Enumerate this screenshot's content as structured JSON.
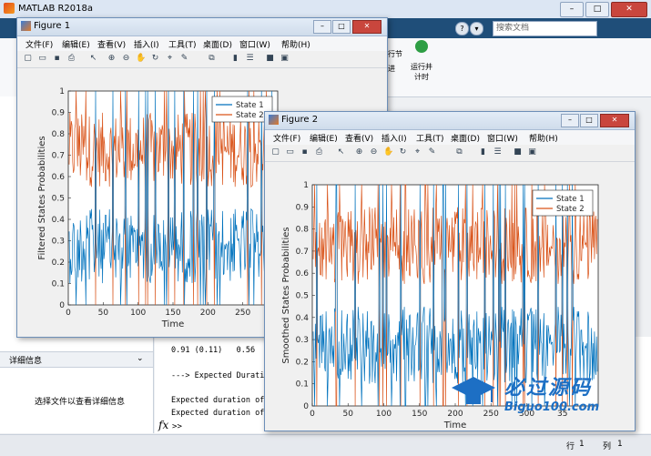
{
  "main_window": {
    "title": "MATLAB R2018a",
    "search_placeholder": "搜索文档",
    "ribbon": {
      "run_advance": "运行并\n计时",
      "run_section": "运行节",
      "advance": "前进"
    },
    "window_controls": {
      "minimize": "–",
      "maximize": "□",
      "close": "✕"
    }
  },
  "left_panel": {
    "details_label": "详细信息",
    "details_message": "选择文件以查看详细信息"
  },
  "command_window": {
    "lines": [
      "0.91 (0.11)   0.56  (",
      "---> Expected Durati",
      "Expected duration of",
      "Expected duration of"
    ],
    "prompt_symbol": "fx",
    "prompt": ">>"
  },
  "status_bar": {
    "row_label": "行",
    "row_value": "1",
    "col_label": "列",
    "col_value": "1"
  },
  "figure1": {
    "title": "Figure 1",
    "menus": [
      "文件(F)",
      "编辑(E)",
      "查看(V)",
      "插入(I)",
      "工具(T)",
      "桌面(D)",
      "窗口(W)",
      "帮助(H)"
    ],
    "chart_data": {
      "type": "line",
      "ylabel": "Filtered States Probabilities",
      "xlabel": "Time",
      "xlim": [
        0,
        300
      ],
      "ylim": [
        0,
        1
      ],
      "xticks": [
        0,
        50,
        100,
        150,
        200,
        250,
        300
      ],
      "yticks": [
        0,
        0.1,
        0.2,
        0.3,
        0.4,
        0.5,
        0.6,
        0.7,
        0.8,
        0.9,
        1
      ],
      "xtick_labels": [
        "0",
        "50",
        "100",
        "150",
        "200",
        "250",
        "30"
      ],
      "legend_position": "top-right",
      "series": [
        {
          "name": "State 1",
          "color": "#0072BD",
          "mean": 0.3
        },
        {
          "name": "State 2",
          "color": "#D95319",
          "mean": 0.7
        }
      ]
    }
  },
  "figure2": {
    "title": "Figure 2",
    "menus": [
      "文件(F)",
      "编辑(E)",
      "查看(V)",
      "插入(I)",
      "工具(T)",
      "桌面(D)",
      "窗口(W)",
      "帮助(H)"
    ],
    "chart_data": {
      "type": "line",
      "ylabel": "Smoothed States Probabilities",
      "xlabel": "Time",
      "xlim": [
        0,
        400
      ],
      "ylim": [
        0,
        1
      ],
      "xticks": [
        0,
        50,
        100,
        150,
        200,
        250,
        300,
        350
      ],
      "yticks": [
        0,
        0.1,
        0.2,
        0.3,
        0.4,
        0.5,
        0.6,
        0.7,
        0.8,
        0.9,
        1
      ],
      "xtick_labels": [
        "0",
        "50",
        "100",
        "150",
        "200",
        "250",
        "300",
        "35"
      ],
      "legend_position": "top-right",
      "series": [
        {
          "name": "State 1",
          "color": "#0072BD",
          "mean": 0.3
        },
        {
          "name": "State 2",
          "color": "#D95319",
          "mean": 0.7
        }
      ]
    }
  },
  "watermark": {
    "brand": "必过源码",
    "url": "Biguo100.com"
  }
}
